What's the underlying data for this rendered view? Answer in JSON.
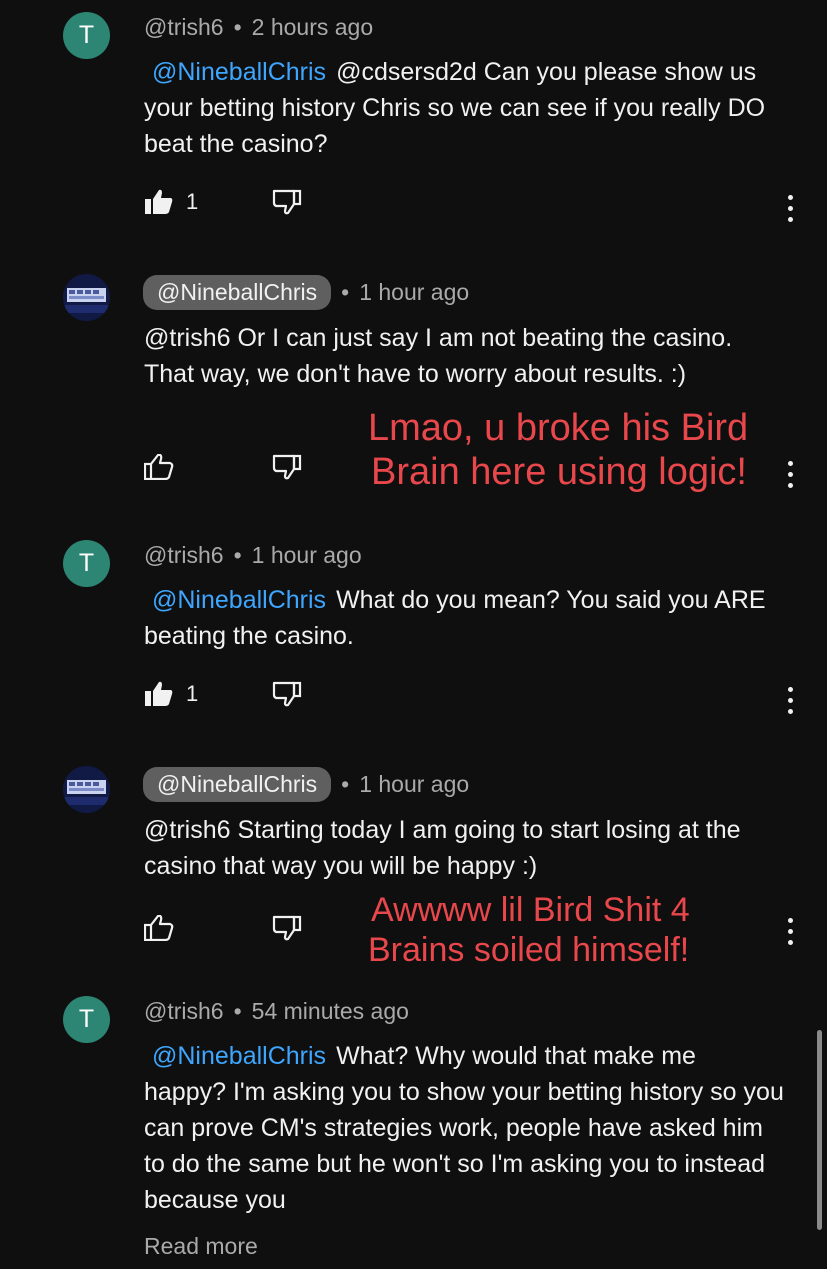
{
  "comments": [
    {
      "avatar": "T",
      "author": "@trish6",
      "time": "2 hours ago",
      "mention": "@NineballChris",
      "text_first": "@cdsersd2d Can you please",
      "text_rest": "show us your betting history Chris so we can see if you really DO beat the casino?",
      "likes": "1"
    },
    {
      "author": "@NineballChris",
      "time": "1 hour ago",
      "text": "@trish6 Or I can just say I am not beating the casino. That way, we don't have to worry about results. :)"
    },
    {
      "avatar": "T",
      "author": "@trish6",
      "time": "1 hour ago",
      "mention": "@NineballChris",
      "text_first": "What do you mean? You said you",
      "text_rest": "ARE beating the casino.",
      "likes": "1"
    },
    {
      "author": "@NineballChris",
      "time": "1 hour ago",
      "text": "@trish6 Starting today I am going to start losing at the casino that way you will be happy :)"
    },
    {
      "avatar": "T",
      "author": "@trish6",
      "time": "54 minutes ago",
      "mention": "@NineballChris",
      "text_first": "What? Why would that make me",
      "text_rest": "happy? I'm asking you to show your betting history so you can prove CM's strategies work, people have asked him to do the same but he won't so I'm asking you to instead because you",
      "read_more": "Read more"
    }
  ],
  "annotations": {
    "first_line1": "Lmao, u broke his Bird",
    "first_line2": "Brain here using logic!",
    "second_line1": "Awwww lil Bird Shit 4",
    "second_line2": "Brains soiled himself!"
  },
  "meta_separator": "•",
  "colors": {
    "background": "#0f0f0f",
    "mention": "#3ea6ff",
    "annotation": "#e8474b",
    "avatar_letter_bg": "#2d8674"
  },
  "icons": [
    "thumbs-up-filled-icon",
    "thumbs-up-outline-icon",
    "thumbs-down-outline-icon",
    "more-vert-icon"
  ]
}
